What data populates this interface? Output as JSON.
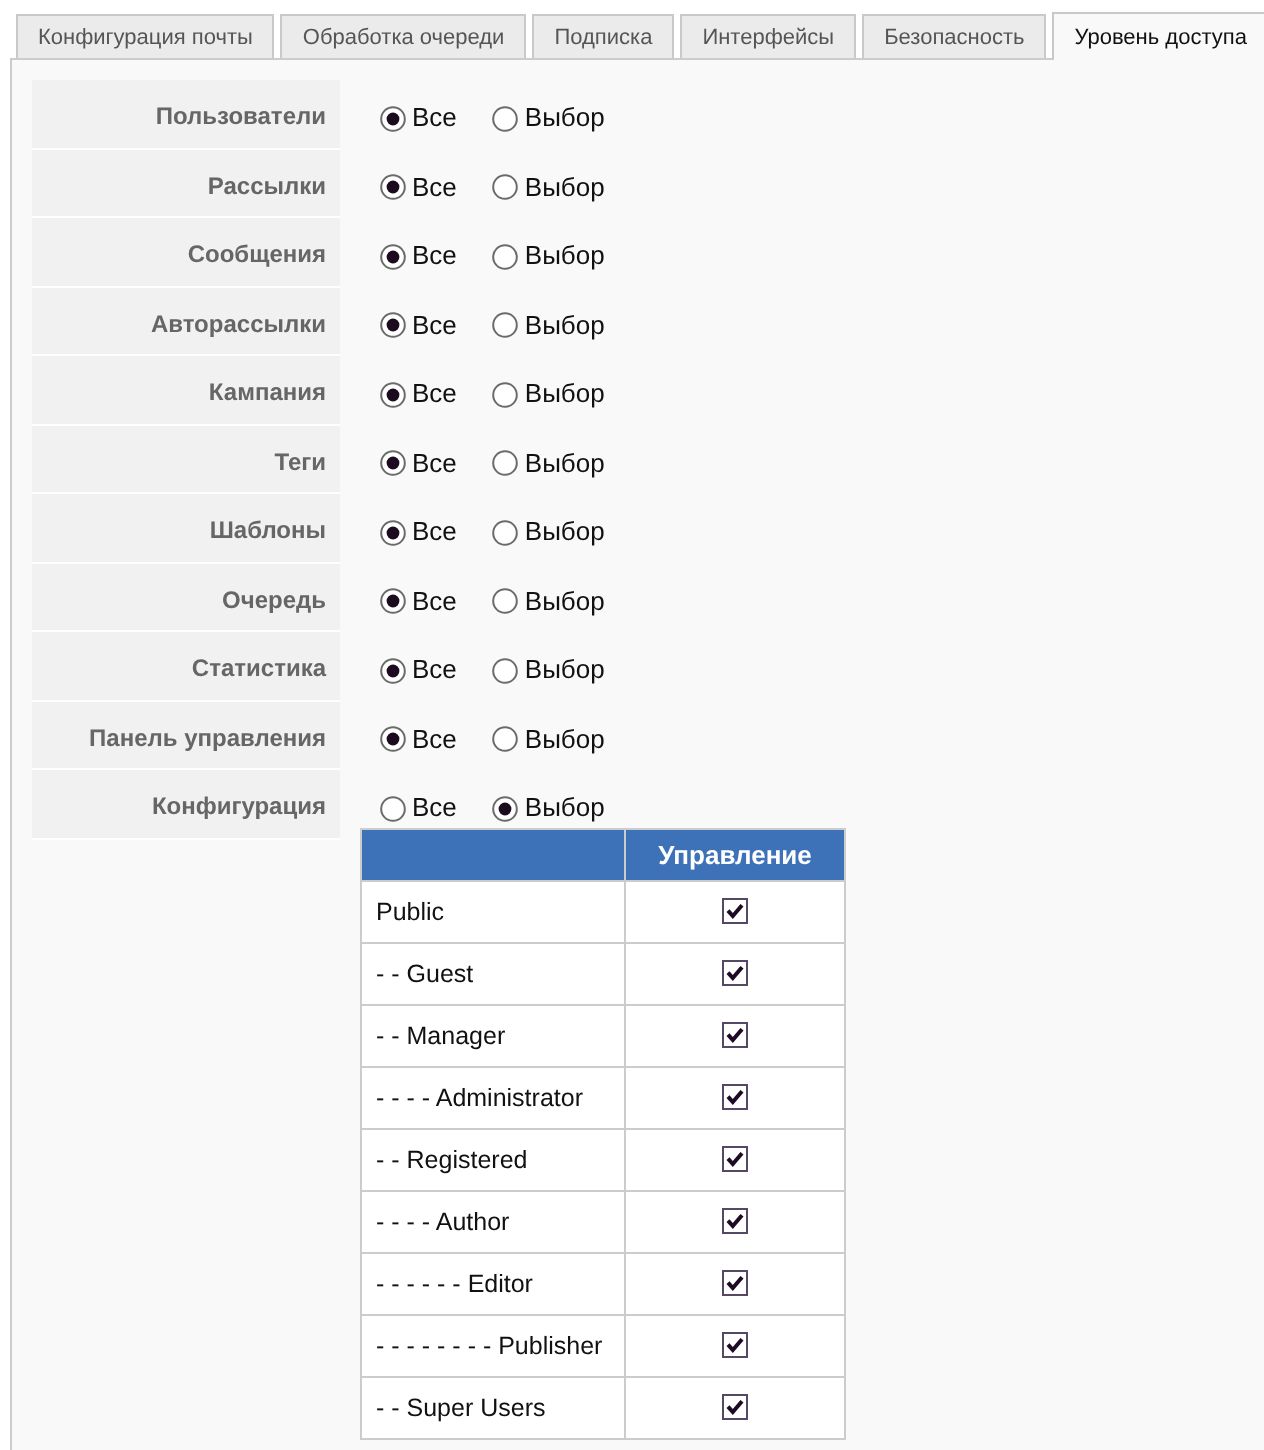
{
  "tabs": [
    {
      "label": "Конфигурация почты",
      "selected": false
    },
    {
      "label": "Обработка очереди",
      "selected": false
    },
    {
      "label": "Подписка",
      "selected": false
    },
    {
      "label": "Интерфейсы",
      "selected": false
    },
    {
      "label": "Безопасность",
      "selected": false
    },
    {
      "label": "Уровень доступа",
      "selected": true
    }
  ],
  "settings": [
    {
      "label": "Пользователи",
      "options": [
        {
          "label": "Все",
          "selected": true
        },
        {
          "label": "Выбор",
          "selected": false
        }
      ]
    },
    {
      "label": "Рассылки",
      "options": [
        {
          "label": "Все",
          "selected": true
        },
        {
          "label": "Выбор",
          "selected": false
        }
      ]
    },
    {
      "label": "Сообщения",
      "options": [
        {
          "label": "Все",
          "selected": true
        },
        {
          "label": "Выбор",
          "selected": false
        }
      ]
    },
    {
      "label": "Авторассылки",
      "options": [
        {
          "label": "Все",
          "selected": true
        },
        {
          "label": "Выбор",
          "selected": false
        }
      ]
    },
    {
      "label": "Кампания",
      "options": [
        {
          "label": "Все",
          "selected": true
        },
        {
          "label": "Выбор",
          "selected": false
        }
      ]
    },
    {
      "label": "Теги",
      "options": [
        {
          "label": "Все",
          "selected": true
        },
        {
          "label": "Выбор",
          "selected": false
        }
      ]
    },
    {
      "label": "Шаблоны",
      "options": [
        {
          "label": "Все",
          "selected": true
        },
        {
          "label": "Выбор",
          "selected": false
        }
      ]
    },
    {
      "label": "Очередь",
      "options": [
        {
          "label": "Все",
          "selected": true
        },
        {
          "label": "Выбор",
          "selected": false
        }
      ]
    },
    {
      "label": "Статистика",
      "options": [
        {
          "label": "Все",
          "selected": true
        },
        {
          "label": "Выбор",
          "selected": false
        }
      ]
    },
    {
      "label": "Панель управления",
      "options": [
        {
          "label": "Все",
          "selected": true
        },
        {
          "label": "Выбор",
          "selected": false
        }
      ]
    },
    {
      "label": "Конфигурация",
      "options": [
        {
          "label": "Все",
          "selected": false
        },
        {
          "label": "Выбор",
          "selected": true
        }
      ],
      "table": {
        "column_header": "Управление",
        "rows": [
          {
            "group": "Public",
            "checked": true
          },
          {
            "group": "- - Guest",
            "checked": true
          },
          {
            "group": "- - Manager",
            "checked": true
          },
          {
            "group": "- - - - Administrator",
            "checked": true
          },
          {
            "group": "- - Registered",
            "checked": true
          },
          {
            "group": "- - - - Author",
            "checked": true
          },
          {
            "group": "- - - - - - Editor",
            "checked": true
          },
          {
            "group": "- - - - - - - - Publisher",
            "checked": true
          },
          {
            "group": "- - Super Users",
            "checked": true
          }
        ]
      }
    }
  ]
}
